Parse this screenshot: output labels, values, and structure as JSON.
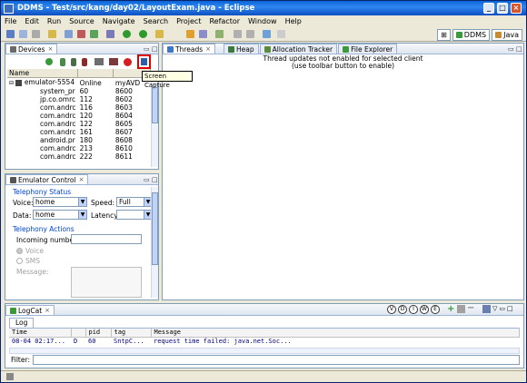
{
  "window": {
    "title": "DDMS - Test/src/kang/day02/LayoutExam.java - Eclipse"
  },
  "menu": [
    "File",
    "Edit",
    "Run",
    "Source",
    "Navigate",
    "Search",
    "Project",
    "Refactor",
    "Window",
    "Help"
  ],
  "perspectives": [
    {
      "label": "DDMS"
    },
    {
      "label": "Java"
    }
  ],
  "devices": {
    "tab_label": "Devices",
    "tooltip": "Screen Capture",
    "columns": [
      "Name",
      "",
      ""
    ],
    "rows": [
      {
        "name": "emulator-5554",
        "pid": "Online",
        "port": "myAVD"
      },
      {
        "name": "system_pr",
        "pid": "60",
        "port": "8600"
      },
      {
        "name": "jp.co.omrc",
        "pid": "112",
        "port": "8602"
      },
      {
        "name": "com.andrc",
        "pid": "116",
        "port": "8603"
      },
      {
        "name": "com.andrc",
        "pid": "120",
        "port": "8604"
      },
      {
        "name": "com.andrc",
        "pid": "122",
        "port": "8605"
      },
      {
        "name": "com.andrc",
        "pid": "161",
        "port": "8607"
      },
      {
        "name": "android.pr",
        "pid": "180",
        "port": "8608"
      },
      {
        "name": "com.andrc",
        "pid": "213",
        "port": "8610"
      },
      {
        "name": "com.andrc",
        "pid": "222",
        "port": "8611"
      }
    ]
  },
  "emulator": {
    "tab_label": "Emulator Control",
    "telephony_status": "Telephony Status",
    "voice_label": "Voice:",
    "voice_value": "home",
    "speed_label": "Speed:",
    "speed_value": "Full",
    "data_label": "Data:",
    "data_value": "home",
    "latency_label": "Latency:",
    "latency_value": "",
    "telephony_actions": "Telephony Actions",
    "incoming_label": "Incoming number:",
    "voice_radio": "Voice",
    "sms_radio": "SMS",
    "message_label": "Message:"
  },
  "right_tabs": [
    "Threads",
    "Heap",
    "Allocation Tracker",
    "File Explorer"
  ],
  "threads_message_1": "Thread updates not enabled for selected client",
  "threads_message_2": "(use toolbar button to enable)",
  "logcat": {
    "tab_label": "LogCat",
    "inner_tab": "Log",
    "levels": [
      "V",
      "D",
      "I",
      "W",
      "E"
    ],
    "columns": [
      "Time",
      "",
      "pid",
      "tag",
      "Message"
    ],
    "rows": [
      {
        "time": "08-04 02:17...",
        "level": "D",
        "pid": "60",
        "tag": "SntpC...",
        "message": "request time failed: java.net.Soc..."
      }
    ],
    "filter_label": "Filter:"
  },
  "colors": {
    "title_blue": "#0a64d8",
    "link_blue": "#0046d5",
    "log_blue": "#000080"
  }
}
